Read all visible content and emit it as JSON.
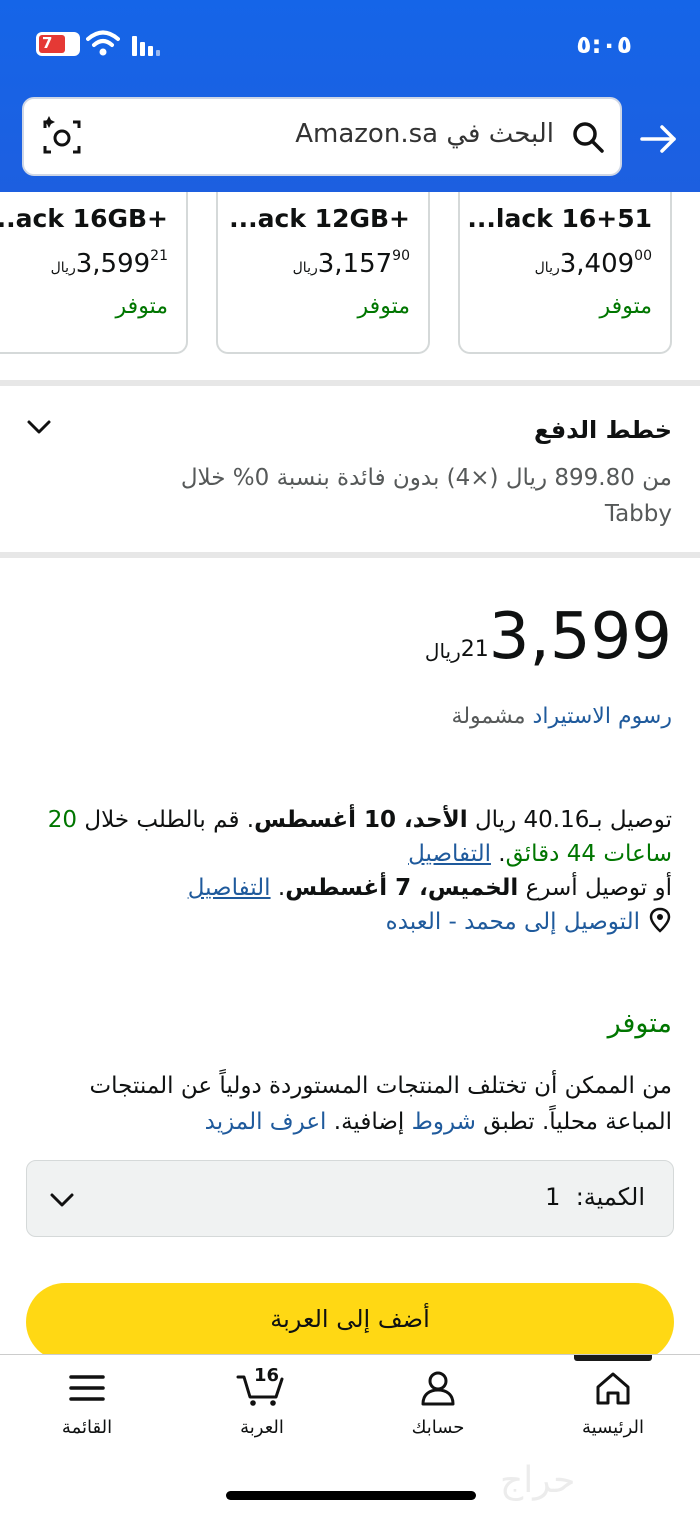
{
  "status_bar": {
    "time": "٥:٠٥",
    "battery_label": "7"
  },
  "search": {
    "placeholder": "البحث في Amazon.sa"
  },
  "carousel": {
    "cards": [
      {
        "title": "...lack 16+51",
        "price_whole": "3,409",
        "price_fraction": "00",
        "currency": "ريال",
        "stock": "متوفر"
      },
      {
        "title": "...ack 12GB+",
        "price_whole": "3,157",
        "price_fraction": "90",
        "currency": "ريال",
        "stock": "متوفر"
      },
      {
        "title": "...ack 16GB+",
        "price_whole": "3,599",
        "price_fraction": "21",
        "currency": "ريال",
        "stock": "متوفر"
      }
    ]
  },
  "payment_plans": {
    "title": "خطط الدفع",
    "description": "من 899.80 ريال (×4) بدون فائدة بنسبة 0% خلال Tabby"
  },
  "price": {
    "whole": "3,599",
    "fraction": "21",
    "currency": "ريال"
  },
  "import_fees": {
    "link": "رسوم الاستيراد",
    "text": "مشمولة"
  },
  "delivery": {
    "line1_prefix": "توصيل بـ40.16 ريال ",
    "line1_date": "الأحد، 10 أغسطس",
    "line1_suffix": ". قم بالطلب خلال ",
    "countdown": "20 ساعات 44 دقائق",
    "details_link": "التفاصيل",
    "line2_prefix": "أو توصيل أسرع ",
    "line2_date": "الخميس، 7 أغسطس",
    "details_link2": "التفاصيل",
    "location": "التوصيل إلى محمد - العبده"
  },
  "availability": "متوفر",
  "import_note": {
    "text": "من الممكن أن تختلف المنتجات المستوردة دولياً عن المنتجات المباعة محلياً. تطبق ",
    "terms_link": "شروط",
    "text2": " إضافية. ",
    "learn_more": "اعرف المزيد"
  },
  "quantity": {
    "label": "الكمية:",
    "value": "1"
  },
  "add_to_cart": "أضف إلى العربة",
  "bottom_nav": {
    "home": "الرئيسية",
    "account": "حسابك",
    "cart": "العربة",
    "cart_count": "16",
    "menu": "القائمة"
  },
  "watermark": "حراج"
}
